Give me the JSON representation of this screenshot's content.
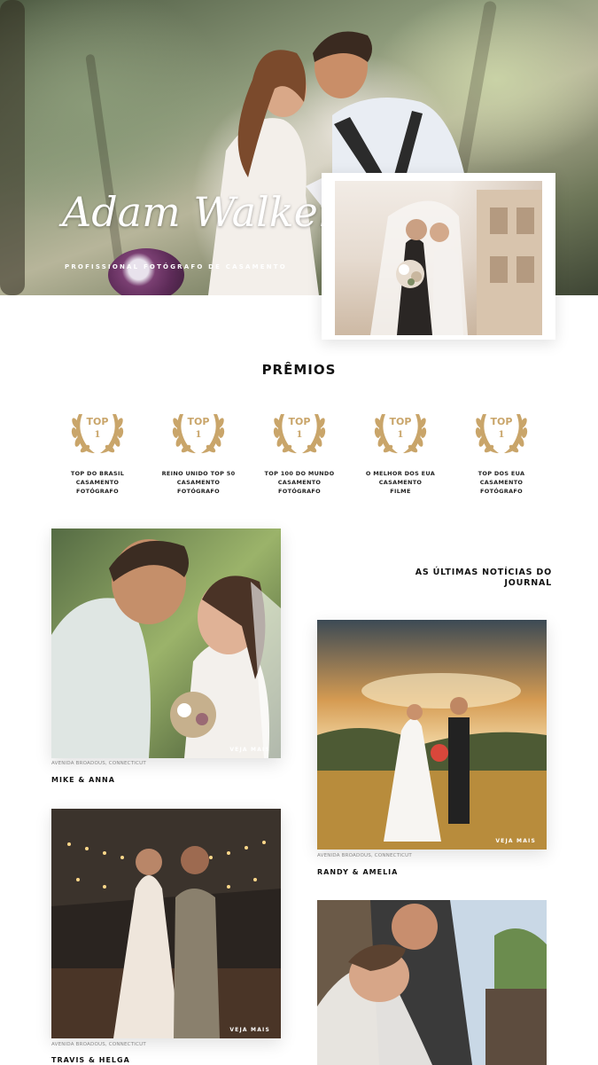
{
  "hero": {
    "title": "Adam Walker",
    "subtitle": "PROFISSIONAL FOTÓGRAFO DE CASAMENTO",
    "prev_icon": "chevron-left-icon",
    "next_icon": "chevron-right-icon",
    "prev_glyph": "‹",
    "next_glyph": "›"
  },
  "awards": {
    "title": "PRÊMIOS",
    "badge_top": "TOP",
    "badge_num": "1",
    "items": [
      {
        "line1": "TOP DO BRASIL",
        "line2": "CASAMENTO",
        "line3": "FOTÓGRAFO"
      },
      {
        "line1": "REINO UNIDO TOP 50",
        "line2": "CASAMENTO",
        "line3": "FOTÓGRAFO"
      },
      {
        "line1": "TOP 100 DO MUNDO",
        "line2": "CASAMENTO",
        "line3": "FOTÓGRAFO"
      },
      {
        "line1": "O MELHOR DOS EUA",
        "line2": "CASAMENTO",
        "line3": "FILME"
      },
      {
        "line1": "TOP DOS EUA",
        "line2": "CASAMENTO",
        "line3": "FOTÓGRAFO"
      }
    ]
  },
  "journal": {
    "title_line1": "AS ÚLTIMAS NOTÍCIAS DO",
    "title_line2": "JOURNAL",
    "more_label": "VEJA MAIS",
    "posts": [
      {
        "location": "AVENIDA BROADOUS, CONNECTICUT",
        "name": "MIKE & ANNA"
      },
      {
        "location": "AVENIDA BROADOUS, CONNECTICUT",
        "name": "RANDY & AMELIA"
      },
      {
        "location": "AVENIDA BROADOUS, CONNECTICUT",
        "name": "TRAVIS & HELGA"
      }
    ]
  },
  "colors": {
    "gold": "#c9a56a",
    "text": "#111111"
  }
}
